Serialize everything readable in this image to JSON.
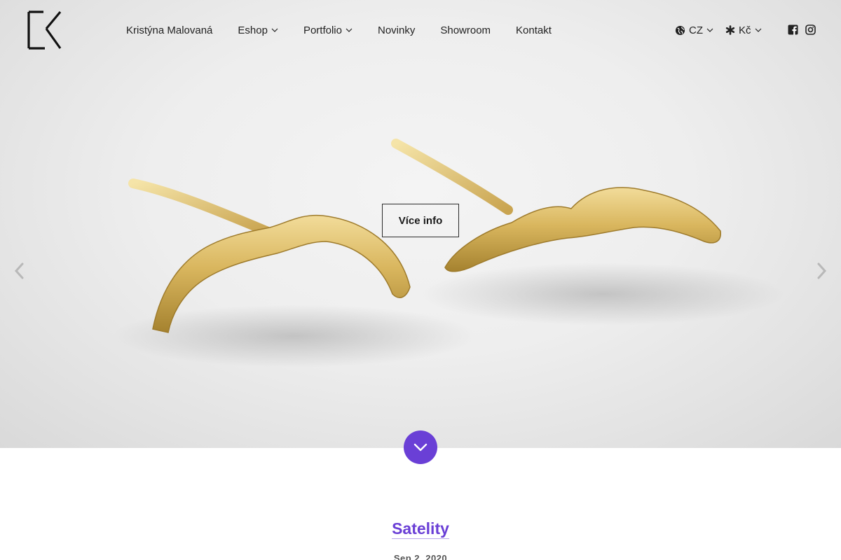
{
  "header": {
    "logo_alt": "K logo",
    "nav": [
      {
        "label": "Kristýna Malovaná",
        "has_dropdown": false
      },
      {
        "label": "Eshop",
        "has_dropdown": true
      },
      {
        "label": "Portfolio",
        "has_dropdown": true
      },
      {
        "label": "Novinky",
        "has_dropdown": false
      },
      {
        "label": "Showroom",
        "has_dropdown": false
      },
      {
        "label": "Kontakt",
        "has_dropdown": false
      }
    ],
    "language": {
      "icon": "globe-icon",
      "value": "CZ"
    },
    "currency": {
      "icon": "asterisk-icon",
      "value": "Kč"
    },
    "social": [
      {
        "icon": "facebook-icon"
      },
      {
        "icon": "instagram-icon"
      }
    ]
  },
  "hero": {
    "cta_label": "Více info",
    "prev_icon": "chevron-left-icon",
    "next_icon": "chevron-right-icon"
  },
  "scroll_down_icon": "chevron-down-icon",
  "article": {
    "title": "Satelity",
    "date": "Sep 2, 2020"
  },
  "colors": {
    "accent": "#6a3fd6",
    "text": "#222222",
    "hero_bg": "#eeeeee",
    "gold": "#d9b65e"
  }
}
